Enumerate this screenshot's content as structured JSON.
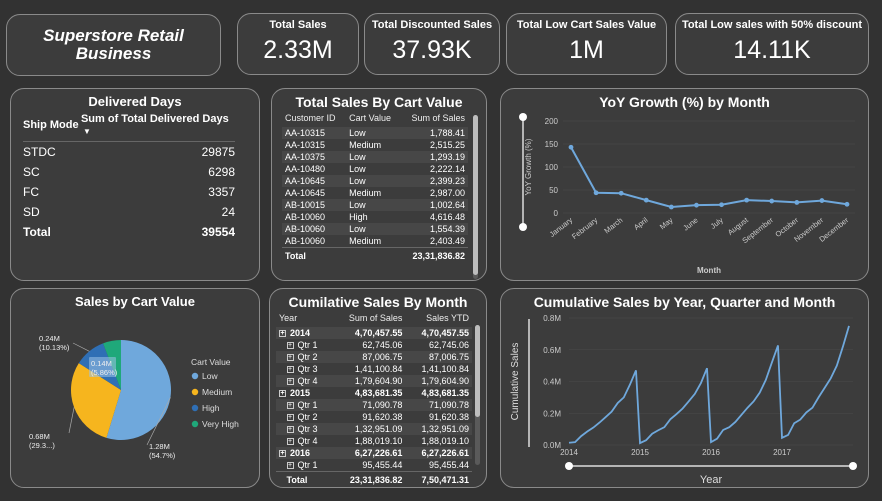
{
  "title": "Superstore Retail Business",
  "kpis": [
    {
      "label": "Total Sales",
      "value": "2.33M"
    },
    {
      "label": "Total Discounted Sales",
      "value": "37.93K"
    },
    {
      "label": "Total Low Cart Sales Value",
      "value": "1M"
    },
    {
      "label": "Total Low sales with 50% discount",
      "value": "14.11K"
    }
  ],
  "delivered": {
    "title": "Delivered Days",
    "col1": "Ship Mode",
    "col2": "Sum of Total Delivered Days",
    "rows": [
      {
        "mode": "STDC",
        "days": "29875"
      },
      {
        "mode": "SC",
        "days": "6298"
      },
      {
        "mode": "FC",
        "days": "3357"
      },
      {
        "mode": "SD",
        "days": "24"
      }
    ],
    "total_label": "Total",
    "total": "39554"
  },
  "cart_table": {
    "title": "Total Sales By Cart Value",
    "headers": [
      "Customer ID",
      "Cart Value",
      "Sum of Sales"
    ],
    "rows": [
      [
        "AA-10315",
        "Low",
        "1,788.41"
      ],
      [
        "AA-10315",
        "Medium",
        "2,515.25"
      ],
      [
        "AA-10375",
        "Low",
        "1,293.19"
      ],
      [
        "AA-10480",
        "Low",
        "2,222.14"
      ],
      [
        "AA-10645",
        "Low",
        "2,399.23"
      ],
      [
        "AA-10645",
        "Medium",
        "2,987.00"
      ],
      [
        "AB-10015",
        "Low",
        "1,002.64"
      ],
      [
        "AB-10060",
        "High",
        "4,616.48"
      ],
      [
        "AB-10060",
        "Low",
        "1,554.39"
      ],
      [
        "AB-10060",
        "Medium",
        "2,403.49"
      ]
    ],
    "total_label": "Total",
    "total": "23,31,836.82"
  },
  "cum_table": {
    "title": "Cumilative Sales By Month",
    "headers": [
      "Year",
      "Sum of Sales",
      "Sales YTD"
    ],
    "rows": [
      {
        "kind": "year",
        "label": "2014",
        "sum": "4,70,457.55",
        "ytd": "4,70,457.55"
      },
      {
        "kind": "qtr",
        "label": "Qtr 1",
        "sum": "62,745.06",
        "ytd": "62,745.06"
      },
      {
        "kind": "qtr",
        "label": "Qtr 2",
        "sum": "87,006.75",
        "ytd": "87,006.75"
      },
      {
        "kind": "qtr",
        "label": "Qtr 3",
        "sum": "1,41,100.84",
        "ytd": "1,41,100.84"
      },
      {
        "kind": "qtr",
        "label": "Qtr 4",
        "sum": "1,79,604.90",
        "ytd": "1,79,604.90"
      },
      {
        "kind": "year",
        "label": "2015",
        "sum": "4,83,681.35",
        "ytd": "4,83,681.35"
      },
      {
        "kind": "qtr",
        "label": "Qtr 1",
        "sum": "71,090.78",
        "ytd": "71,090.78"
      },
      {
        "kind": "qtr",
        "label": "Qtr 2",
        "sum": "91,620.38",
        "ytd": "91,620.38"
      },
      {
        "kind": "qtr",
        "label": "Qtr 3",
        "sum": "1,32,951.09",
        "ytd": "1,32,951.09"
      },
      {
        "kind": "qtr",
        "label": "Qtr 4",
        "sum": "1,88,019.10",
        "ytd": "1,88,019.10"
      },
      {
        "kind": "year",
        "label": "2016",
        "sum": "6,27,226.61",
        "ytd": "6,27,226.61"
      },
      {
        "kind": "qtr",
        "label": "Qtr 1",
        "sum": "95,455.44",
        "ytd": "95,455.44"
      }
    ],
    "total_label": "Total",
    "total_sum": "23,31,836.82",
    "total_ytd": "7,50,471.31"
  },
  "chart_data": [
    {
      "type": "line",
      "title": "YoY Growth (%) by Month",
      "xlabel": "Month",
      "ylabel": "YoY Growth (%)",
      "categories": [
        "January",
        "February",
        "March",
        "April",
        "May",
        "June",
        "July",
        "August",
        "September",
        "October",
        "November",
        "December"
      ],
      "values": [
        143,
        44,
        43,
        28,
        13,
        17,
        18,
        28,
        26,
        23,
        27,
        19
      ],
      "ylim": [
        0,
        200
      ],
      "yticks": [
        "0",
        "50",
        "100",
        "150",
        "200"
      ],
      "color": "#6fa8dc"
    },
    {
      "type": "pie",
      "title": "Sales by Cart Value",
      "legend_title": "Cart Value",
      "slices": [
        {
          "name": "Low",
          "value": 54.7,
          "label": "1.28M",
          "pct": "(54.7%)",
          "color": "#6fa8dc"
        },
        {
          "name": "Medium",
          "value": 29.3,
          "label": "0.68M",
          "pct": "(29.3...)",
          "color": "#f6b51e"
        },
        {
          "name": "High",
          "value": 10.13,
          "label": "0.24M",
          "pct": "(10.13%)",
          "color": "#2f6fb5"
        },
        {
          "name": "Very High",
          "value": 5.86,
          "label": "0.14M",
          "pct": "(5.86%)",
          "color": "#1fa87a"
        }
      ]
    },
    {
      "type": "line",
      "title": "Cumulative Sales by Year, Quarter and Month",
      "xlabel": "Year",
      "ylabel": "Cumulative Sales",
      "x_ticks": [
        "2014",
        "2015",
        "2016",
        "2017"
      ],
      "yticks": [
        "0.0M",
        "0.2M",
        "0.4M",
        "0.6M",
        "0.8M"
      ],
      "ylim": [
        0,
        0.8
      ],
      "series_values": [
        [
          0.014,
          0.018,
          0.056,
          0.085,
          0.11,
          0.141,
          0.175,
          0.21,
          0.265,
          0.3,
          0.38,
          0.47
        ],
        [
          0.012,
          0.03,
          0.071,
          0.093,
          0.112,
          0.163,
          0.195,
          0.23,
          0.275,
          0.322,
          0.39,
          0.484
        ],
        [
          0.018,
          0.04,
          0.095,
          0.112,
          0.145,
          0.19,
          0.235,
          0.275,
          0.33,
          0.41,
          0.52,
          0.627
        ],
        [
          0.045,
          0.063,
          0.137,
          0.16,
          0.205,
          0.235,
          0.3,
          0.36,
          0.42,
          0.5,
          0.62,
          0.75
        ]
      ],
      "color": "#6fa8dc"
    }
  ]
}
